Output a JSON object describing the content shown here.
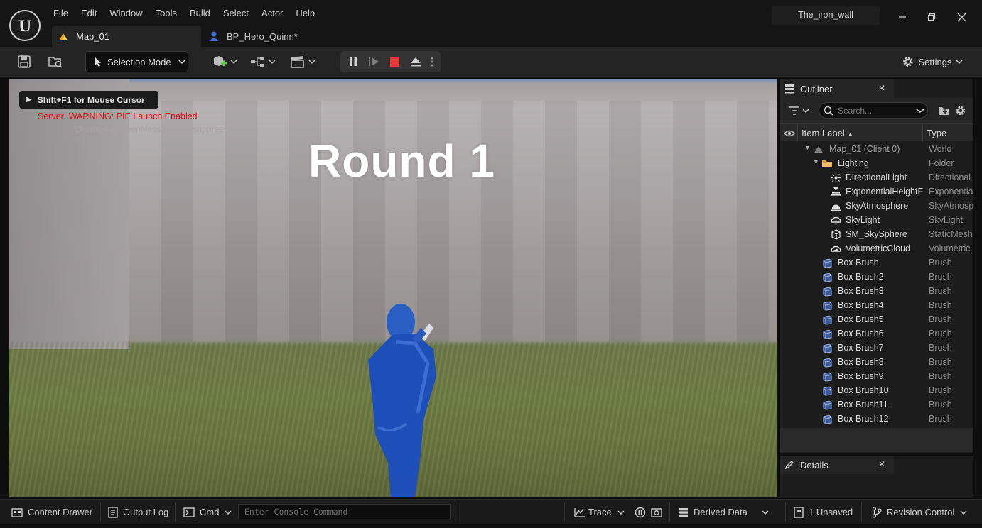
{
  "app": {
    "logo_text": "U",
    "project_name": "The_iron_wall",
    "menu": [
      "File",
      "Edit",
      "Window",
      "Tools",
      "Build",
      "Select",
      "Actor",
      "Help"
    ],
    "tabs": [
      {
        "label": "Map_01",
        "icon": "level-icon",
        "active": true
      },
      {
        "label": "BP_Hero_Quinn*",
        "icon": "blueprint-icon",
        "active": false
      }
    ],
    "window_controls": [
      "minimize-icon",
      "restore-icon",
      "close-icon"
    ]
  },
  "toolbar": {
    "mode_label": "Selection Mode",
    "settings_label": "Settings",
    "play_controls": [
      "pause-icon",
      "step-icon",
      "stop-icon",
      "eject-icon"
    ],
    "colors": {
      "stop": "#e83838"
    }
  },
  "viewport": {
    "mouse_hint": "Shift+F1 for Mouse Cursor",
    "warning": "Server: WARNING: PIE Launch Enabled",
    "warning_sub": "'DisableAllScreenMessages' to suppress",
    "round_text": "Round 1",
    "colors": {
      "warning": "#e01010"
    }
  },
  "outliner": {
    "title": "Outliner",
    "search_placeholder": "Search...",
    "columns": [
      "Item Label",
      "Type"
    ],
    "rows": [
      {
        "label": "Map_01 (Client 0)",
        "type": "World",
        "depth": 0,
        "expander": "▼",
        "icon": "world-icon",
        "dim": true
      },
      {
        "label": "Lighting",
        "type": "Folder",
        "depth": 1,
        "expander": "▼",
        "icon": "folder-icon"
      },
      {
        "label": "DirectionalLight",
        "type": "Directional",
        "depth": 2,
        "icon": "directional-light-icon"
      },
      {
        "label": "ExponentialHeightF",
        "type": "Exponentia",
        "depth": 2,
        "icon": "height-fog-icon"
      },
      {
        "label": "SkyAtmosphere",
        "type": "SkyAtmosp",
        "depth": 2,
        "icon": "sky-atmosphere-icon"
      },
      {
        "label": "SkyLight",
        "type": "SkyLight",
        "depth": 2,
        "icon": "sky-light-icon"
      },
      {
        "label": "SM_SkySphere",
        "type": "StaticMesh",
        "depth": 2,
        "icon": "static-mesh-icon"
      },
      {
        "label": "VolumetricCloud",
        "type": "Volumetric",
        "depth": 2,
        "icon": "volumetric-cloud-icon"
      },
      {
        "label": "Box Brush",
        "type": "Brush",
        "depth": 1,
        "icon": "brush-icon"
      },
      {
        "label": "Box Brush2",
        "type": "Brush",
        "depth": 1,
        "icon": "brush-icon"
      },
      {
        "label": "Box Brush3",
        "type": "Brush",
        "depth": 1,
        "icon": "brush-icon"
      },
      {
        "label": "Box Brush4",
        "type": "Brush",
        "depth": 1,
        "icon": "brush-icon"
      },
      {
        "label": "Box Brush5",
        "type": "Brush",
        "depth": 1,
        "icon": "brush-icon"
      },
      {
        "label": "Box Brush6",
        "type": "Brush",
        "depth": 1,
        "icon": "brush-icon"
      },
      {
        "label": "Box Brush7",
        "type": "Brush",
        "depth": 1,
        "icon": "brush-icon"
      },
      {
        "label": "Box Brush8",
        "type": "Brush",
        "depth": 1,
        "icon": "brush-icon"
      },
      {
        "label": "Box Brush9",
        "type": "Brush",
        "depth": 1,
        "icon": "brush-icon"
      },
      {
        "label": "Box Brush10",
        "type": "Brush",
        "depth": 1,
        "icon": "brush-icon"
      },
      {
        "label": "Box Brush11",
        "type": "Brush",
        "depth": 1,
        "icon": "brush-icon"
      },
      {
        "label": "Box Brush12",
        "type": "Brush",
        "depth": 1,
        "icon": "brush-icon"
      }
    ]
  },
  "details": {
    "title": "Details"
  },
  "statusbar": {
    "content_drawer": "Content Drawer",
    "output_log": "Output Log",
    "cmd": "Cmd",
    "console_placeholder": "Enter Console Command",
    "trace": "Trace",
    "derived_data": "Derived Data",
    "unsaved": "1 Unsaved",
    "revision_control": "Revision Control"
  }
}
